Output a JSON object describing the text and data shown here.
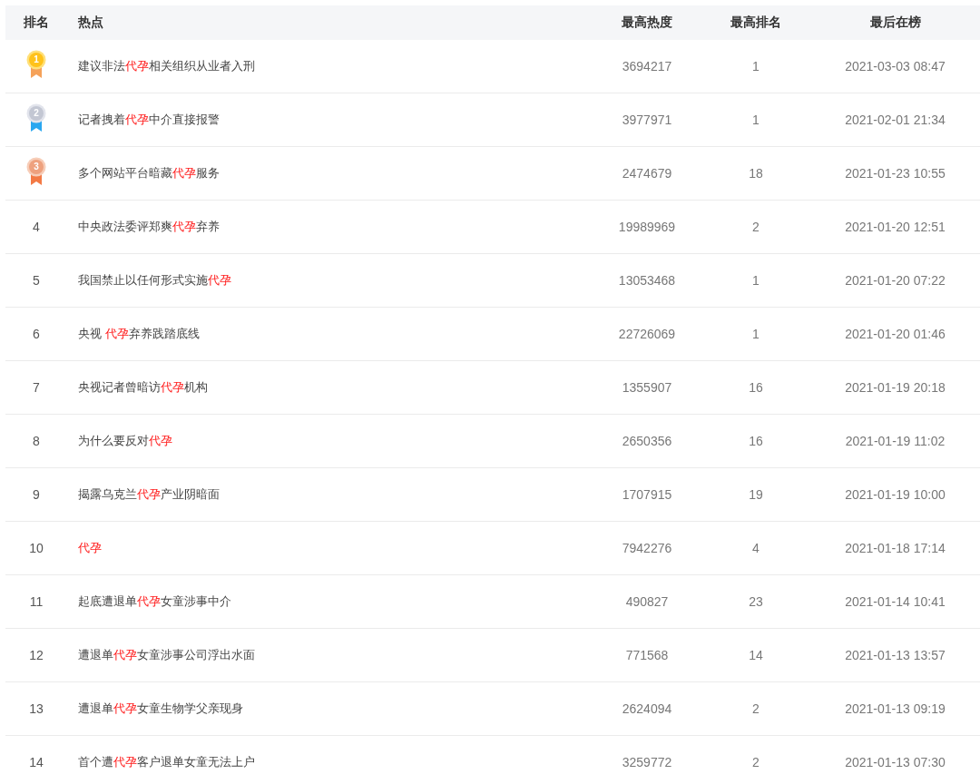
{
  "table": {
    "columns": [
      "排名",
      "热点",
      "最高热度",
      "最高排名",
      "最后在榜"
    ],
    "rows": [
      {
        "rank": "1",
        "kind": "gold",
        "topic": [
          {
            "text": "建议非法",
            "highlight": false
          },
          {
            "text": "代孕",
            "highlight": true
          },
          {
            "text": "相关组织从业者入刑",
            "highlight": false
          }
        ],
        "peak_heat": "3694217",
        "peak_rank": "1",
        "last_on_list": "2021-03-03 08:47"
      },
      {
        "rank": "2",
        "kind": "silver",
        "topic": [
          {
            "text": "记者拽着",
            "highlight": false
          },
          {
            "text": "代孕",
            "highlight": true
          },
          {
            "text": "中介直接报警",
            "highlight": false
          }
        ],
        "peak_heat": "3977971",
        "peak_rank": "1",
        "last_on_list": "2021-02-01 21:34"
      },
      {
        "rank": "3",
        "kind": "bronze",
        "topic": [
          {
            "text": "多个网站平台暗藏",
            "highlight": false
          },
          {
            "text": "代孕",
            "highlight": true
          },
          {
            "text": "服务",
            "highlight": false
          }
        ],
        "peak_heat": "2474679",
        "peak_rank": "18",
        "last_on_list": "2021-01-23 10:55"
      },
      {
        "rank": "4",
        "kind": "plain",
        "topic": [
          {
            "text": "中央政法委评郑爽",
            "highlight": false
          },
          {
            "text": "代孕",
            "highlight": true
          },
          {
            "text": "弃养",
            "highlight": false
          }
        ],
        "peak_heat": "19989969",
        "peak_rank": "2",
        "last_on_list": "2021-01-20 12:51"
      },
      {
        "rank": "5",
        "kind": "plain",
        "topic": [
          {
            "text": "我国禁止以任何形式实施",
            "highlight": false
          },
          {
            "text": "代孕",
            "highlight": true
          }
        ],
        "peak_heat": "13053468",
        "peak_rank": "1",
        "last_on_list": "2021-01-20 07:22"
      },
      {
        "rank": "6",
        "kind": "plain",
        "topic": [
          {
            "text": "央视 ",
            "highlight": false
          },
          {
            "text": "代孕",
            "highlight": true
          },
          {
            "text": "弃养践踏底线",
            "highlight": false
          }
        ],
        "peak_heat": "22726069",
        "peak_rank": "1",
        "last_on_list": "2021-01-20 01:46"
      },
      {
        "rank": "7",
        "kind": "plain",
        "topic": [
          {
            "text": "央视记者曾暗访",
            "highlight": false
          },
          {
            "text": "代孕",
            "highlight": true
          },
          {
            "text": "机构",
            "highlight": false
          }
        ],
        "peak_heat": "1355907",
        "peak_rank": "16",
        "last_on_list": "2021-01-19 20:18"
      },
      {
        "rank": "8",
        "kind": "plain",
        "topic": [
          {
            "text": "为什么要反对",
            "highlight": false
          },
          {
            "text": "代孕",
            "highlight": true
          }
        ],
        "peak_heat": "2650356",
        "peak_rank": "16",
        "last_on_list": "2021-01-19 11:02"
      },
      {
        "rank": "9",
        "kind": "plain",
        "topic": [
          {
            "text": "揭露乌克兰",
            "highlight": false
          },
          {
            "text": "代孕",
            "highlight": true
          },
          {
            "text": "产业阴暗面",
            "highlight": false
          }
        ],
        "peak_heat": "1707915",
        "peak_rank": "19",
        "last_on_list": "2021-01-19 10:00"
      },
      {
        "rank": "10",
        "kind": "plain",
        "topic": [
          {
            "text": "代孕",
            "highlight": true
          }
        ],
        "peak_heat": "7942276",
        "peak_rank": "4",
        "last_on_list": "2021-01-18 17:14"
      },
      {
        "rank": "11",
        "kind": "plain",
        "topic": [
          {
            "text": "起底遭退单",
            "highlight": false
          },
          {
            "text": "代孕",
            "highlight": true
          },
          {
            "text": "女童涉事中介",
            "highlight": false
          }
        ],
        "peak_heat": "490827",
        "peak_rank": "23",
        "last_on_list": "2021-01-14 10:41"
      },
      {
        "rank": "12",
        "kind": "plain",
        "topic": [
          {
            "text": "遭退单",
            "highlight": false
          },
          {
            "text": "代孕",
            "highlight": true
          },
          {
            "text": "女童涉事公司浮出水面",
            "highlight": false
          }
        ],
        "peak_heat": "771568",
        "peak_rank": "14",
        "last_on_list": "2021-01-13 13:57"
      },
      {
        "rank": "13",
        "kind": "plain",
        "topic": [
          {
            "text": "遭退单",
            "highlight": false
          },
          {
            "text": "代孕",
            "highlight": true
          },
          {
            "text": "女童生物学父亲现身",
            "highlight": false
          }
        ],
        "peak_heat": "2624094",
        "peak_rank": "2",
        "last_on_list": "2021-01-13 09:19"
      },
      {
        "rank": "14",
        "kind": "plain",
        "topic": [
          {
            "text": "首个遭",
            "highlight": false
          },
          {
            "text": "代孕",
            "highlight": true
          },
          {
            "text": "客户退单女童无法上户",
            "highlight": false
          }
        ],
        "peak_heat": "3259772",
        "peak_rank": "2",
        "last_on_list": "2021-01-13 07:30"
      }
    ]
  }
}
